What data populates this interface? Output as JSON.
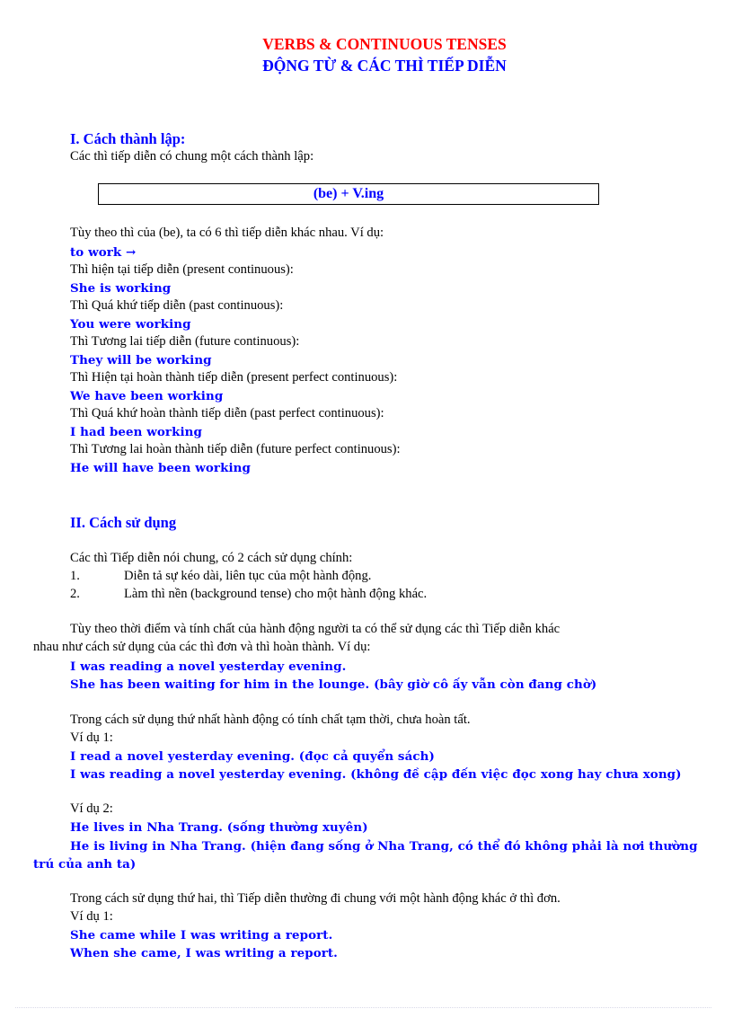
{
  "document": {
    "title_en": "VERBS & CONTINUOUS TENSES",
    "title_vi": "ĐỘNG TỪ & CÁC THÌ TIẾP DIỄN"
  },
  "section1": {
    "heading": "I. Cách thành lập:",
    "intro": "Các thì tiếp diễn có chung một cách thành lập:",
    "formula": "(be) + V.ing",
    "note": "Tùy theo thì của (be), ta có 6 thì tiếp diễn khác nhau.  Ví dụ:",
    "base_verb": "to work →",
    "tenses": [
      {
        "label": "Thì hiện tại tiếp diễn (present continuous):",
        "example": "She is working"
      },
      {
        "label": "Thì Quá khứ tiếp diễn (past continuous):",
        "example": "You were working"
      },
      {
        "label": "Thì Tương  lai tiếp diễn (future continuous):",
        "example": "They will be working"
      },
      {
        "label": "Thì Hiện tại hoàn thành tiếp diễn (present perfect continuous):",
        "example": "We have been working"
      },
      {
        "label": "Thì Quá khứ hoàn thành tiếp diễn (past perfect continuous):",
        "example": "I had been working"
      },
      {
        "label": "Thì Tương  lai hoàn thành tiếp diễn (future perfect continuous):",
        "example": "He will have been working"
      }
    ]
  },
  "section2": {
    "heading": "II. Cách sử dụng",
    "intro": "Các thì Tiếp diễn nói chung, có 2 cách sử dụng chính:",
    "uses": [
      {
        "num": "1.",
        "text": "Diễn tả sự kéo dài, liên tục của một hành động."
      },
      {
        "num": "2.",
        "text": "Làm thì nền (background  tense) cho một hành động khác."
      }
    ],
    "para1_line1": "Tùy theo thời điểm và tính chất của hành động người ta có thể sử dụng các thì Tiếp diễn khác",
    "para1_line2": "nhau như cách sử dụng của các thì đơn và thì hoàn thành.  Ví dụ:",
    "para1_examples": [
      "I was reading a novel yesterday evening.",
      "She has been waiting for him in the lounge. (bây giờ cô ấy vẫn còn đang chờ)"
    ],
    "para2": "Trong cách sử dụng thứ nhất hành động có tính chất tạm thời, chưa hoàn tất.",
    "para2_ex1_label": "Ví dụ 1:",
    "para2_ex1": [
      "I read a novel yesterday evening. (đọc cả quyển  sách)",
      "I was reading a novel yesterday evening. (không đề cập đến việc đọc xong hay chưa xong)"
    ],
    "para2_ex2_label": "Ví dụ 2:",
    "para2_ex2_line1": "He lives in Nha Trang.  (sống thường xuyên)",
    "para2_ex2_line2a": "He is living in Nha Trang.  (hiện đang sống ở Nha  Trang, có thể đó không phải là nơi thường",
    "para2_ex2_line2b": "trú của anh ta)",
    "para3": "Trong cách sử dụng thứ hai, thì Tiếp diễn thường đi chung với một hành động khác ở thì đơn.",
    "para3_ex1_label": "Ví dụ 1:",
    "para3_ex1": [
      "She came while I was writing a report.",
      "When she came, I was writing a report."
    ]
  }
}
